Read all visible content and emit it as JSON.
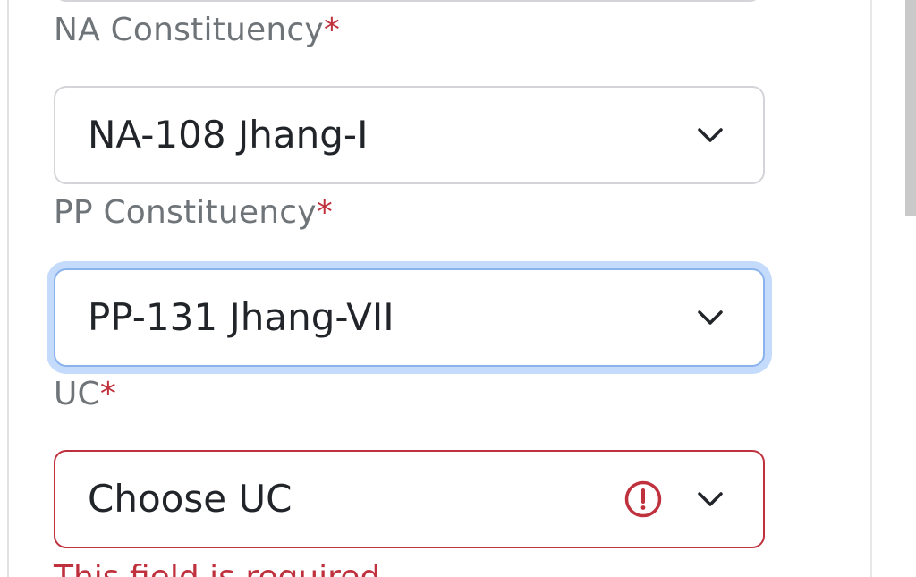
{
  "form": {
    "na_constituency": {
      "label": "NA Constituency",
      "required_marker": "*",
      "value": "NA-108 Jhang-I",
      "icon": "chevron-down-icon"
    },
    "pp_constituency": {
      "label": "PP Constituency",
      "required_marker": "*",
      "value": "PP-131 Jhang-VII",
      "icon": "chevron-down-icon",
      "state": "focused"
    },
    "uc": {
      "label": "UC",
      "required_marker": "*",
      "value": "Choose UC",
      "icon": "chevron-down-icon",
      "status_icon": "alert-circle-icon",
      "state": "invalid",
      "error_message": "This field is required."
    }
  },
  "colors": {
    "label": "#6f7479",
    "required": "#c0313e",
    "error": "#c0313e",
    "focus_border": "#8ab3ee",
    "focus_glow": "#c5dbfb",
    "value_text": "#212529",
    "default_border": "#d3d5d8"
  }
}
